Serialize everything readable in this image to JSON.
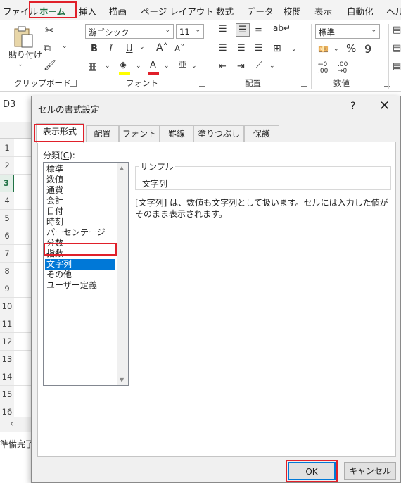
{
  "ribbon_tabs": [
    "ファイル",
    "ホーム",
    "挿入",
    "描画",
    "ページ レイアウト",
    "数式",
    "データ",
    "校閲",
    "表示",
    "自動化",
    "ヘルプ"
  ],
  "clipboard": {
    "paste_label": "貼り付け",
    "group_label": "クリップボード"
  },
  "font": {
    "name": "游ゴシック",
    "size": "11",
    "group_label": "フォント"
  },
  "alignment": {
    "group_label": "配置"
  },
  "number": {
    "format": "標準",
    "group_label": "数値"
  },
  "colors": {
    "accent_green": "#217346",
    "highlight_red": "#e0202a",
    "selection_blue": "#0078d7"
  },
  "icons": [
    "paste-icon",
    "cut-icon",
    "copy-icon",
    "format-painter-icon",
    "bold-icon",
    "italic-icon",
    "underline-icon",
    "grow-font-icon",
    "shrink-font-icon",
    "border-icon",
    "fill-color-icon",
    "font-color-icon",
    "phonetic-icon",
    "align-top-icon",
    "align-middle-icon",
    "align-bottom-icon",
    "orientation-icon",
    "wrap-text-icon",
    "align-left-icon",
    "align-center-icon",
    "align-right-icon",
    "merge-icon",
    "indent-decrease-icon",
    "indent-increase-icon",
    "currency-icon",
    "percent-icon",
    "comma-icon",
    "increase-decimal-icon",
    "decrease-decimal-icon"
  ],
  "sheet": {
    "name_box": "D3",
    "rows": [
      "1",
      "2",
      "3",
      "4",
      "5",
      "6",
      "7",
      "8",
      "9",
      "10",
      "11",
      "12",
      "13",
      "14",
      "15",
      "16"
    ],
    "status": "準備完了"
  },
  "dialog": {
    "title": "セルの書式設定",
    "help": "?",
    "close": "✕",
    "tabs": [
      "表示形式",
      "配置",
      "フォント",
      "罫線",
      "塗りつぶし",
      "保護"
    ],
    "category_label_prefix": "分類(",
    "category_label_key": "C",
    "category_label_suffix": "):",
    "categories": [
      "標準",
      "数値",
      "通貨",
      "会計",
      "日付",
      "時刻",
      "パーセンテージ",
      "分数",
      "指数",
      "文字列",
      "その他",
      "ユーザー定義"
    ],
    "selected_category": "文字列",
    "sample_label": "サンプル",
    "sample_value": "文字列",
    "description": "[文字列] は、数値も文字列として扱います。セルには入力した値がそのまま表示されます。",
    "ok_label": "OK",
    "cancel_label": "キャンセル"
  }
}
